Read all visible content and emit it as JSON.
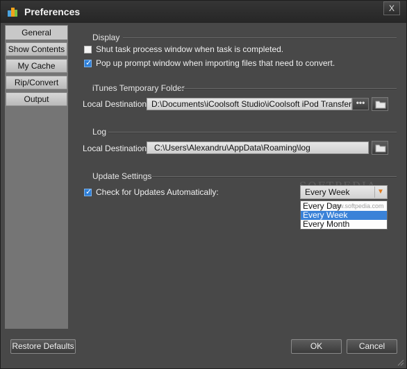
{
  "window": {
    "title": "Preferences",
    "close_label": "X"
  },
  "sidebar": {
    "items": [
      {
        "label": "General",
        "active": true
      },
      {
        "label": "Show Contents"
      },
      {
        "label": "My Cache"
      },
      {
        "label": "Rip/Convert"
      },
      {
        "label": "Output"
      }
    ]
  },
  "display": {
    "title": "Display",
    "shut_task_label": "Shut task process window when task is completed.",
    "shut_task_checked": false,
    "popup_label": "Pop up prompt window when importing files that need to convert.",
    "popup_checked": true
  },
  "itunes_folder": {
    "title": "iTunes Temporary Folder",
    "dest_label": "Local Destination:",
    "path": "D:\\Documents\\iCoolsoft Studio\\iCoolsoft iPod Transfer\\iTunes",
    "browse_label": "•••"
  },
  "log": {
    "title": "Log",
    "dest_label": "Local Destination:",
    "path": "C:\\Users\\Alexandru\\AppData\\Roaming\\log"
  },
  "update": {
    "title": "Update Settings",
    "check_label": "Check for Updates Automatically:",
    "checked": true,
    "selected": "Every Week",
    "options": [
      "Every Day",
      "Every Week",
      "Every Month"
    ]
  },
  "watermark": {
    "text": "SOFTPEDIA",
    "url": "www.softpedia.com"
  },
  "footer": {
    "restore_label": "Restore Defaults",
    "ok_label": "OK",
    "cancel_label": "Cancel"
  },
  "colors": {
    "accent": "#3a82d8",
    "checkbox": "#2e7fd8",
    "arrow": "#e07a1c"
  },
  "icons": {
    "app": "app-logo-icon",
    "folder": "folder-icon"
  }
}
